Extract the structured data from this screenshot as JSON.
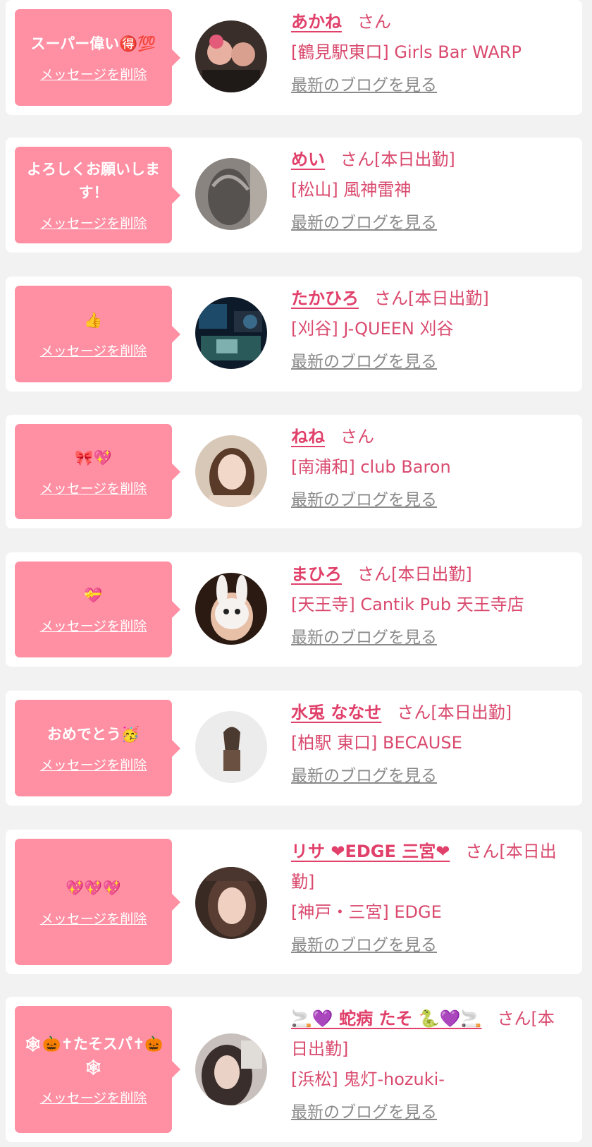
{
  "delete_label": "メッセージを削除",
  "blog_label": "最新のブログを見る",
  "san_suffix": "さん",
  "colors": {
    "bubble": "#ff8fa3",
    "name": "#e0406a",
    "text": "#d94a6e",
    "link_gray": "#8a8a8a"
  },
  "cards": [
    {
      "message": "スーパー偉い🉐💯",
      "name": "あかね",
      "status": "",
      "shop": "[鶴見駅東口] Girls Bar WARP",
      "avatar_icon": "avatar-photo"
    },
    {
      "message": "よろしくお願いします！",
      "name": "めい",
      "status": "[本日出勤]",
      "shop": "[松山] 風神雷神",
      "avatar_icon": "avatar-photo"
    },
    {
      "message": "👍",
      "name": "たかひろ",
      "status": "[本日出勤]",
      "shop": "[刈谷] J-QUEEN 刈谷",
      "avatar_icon": "avatar-photo"
    },
    {
      "message": "🎀💖",
      "name": "ねね",
      "status": "",
      "shop": "[南浦和] club Baron",
      "avatar_icon": "avatar-photo"
    },
    {
      "message": "💝",
      "name": "まひろ",
      "status": "[本日出勤]",
      "shop": "[天王寺] Cantik Pub 天王寺店",
      "avatar_icon": "avatar-photo"
    },
    {
      "message": "おめでとう🥳",
      "name": "水兎 ななせ",
      "status": "[本日出勤]",
      "shop": "[柏駅 東口] BECAUSE",
      "avatar_icon": "avatar-photo"
    },
    {
      "message": "💖💖💖",
      "name": "リサ ❤EDGE 三宮❤",
      "status": "[本日出勤]",
      "shop": "[神戸・三宮] EDGE",
      "avatar_icon": "avatar-photo"
    },
    {
      "message": "🕸🎃✝たそスパ✝🎃🕸",
      "name": "🚬💜 蛇病 たそ 🐍💜🚬",
      "status": "[本日出勤]",
      "shop": "[浜松] 鬼灯-hozuki-",
      "avatar_icon": "avatar-photo"
    }
  ]
}
